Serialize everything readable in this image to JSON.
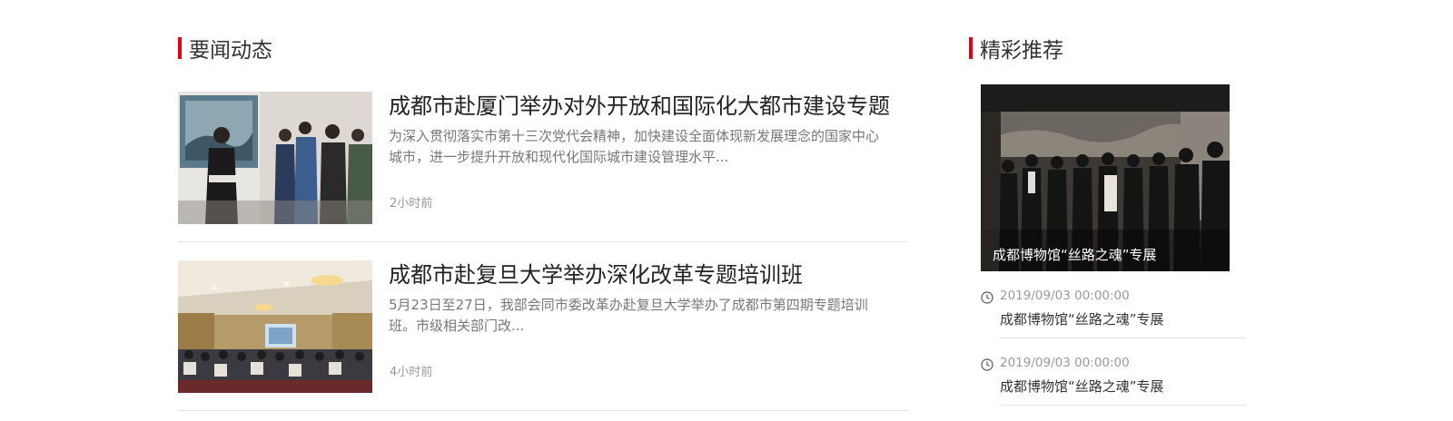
{
  "news_section": {
    "title": "要闻动态",
    "items": [
      {
        "headline": "成都市赴厦门举办对外开放和国际化大都市建设专题",
        "summary": "为深入贯彻落实市第十三次党代会精神，加快建设全面体现新发展理念的国家中心城市，进一步提升开放和现代化国际城市建设管理水平...",
        "time": "2小时前"
      },
      {
        "headline": "成都市赴复旦大学举办深化改革专题培训班",
        "summary": "5月23日至27日，我部会同市委改革办赴复旦大学举办了成都市第四期专题培训班。市级相关部门改...",
        "time": "4小时前"
      }
    ]
  },
  "recommend_section": {
    "title": "精彩推荐",
    "feature_caption": "成都博物馆“丝路之魂”专展",
    "items": [
      {
        "date": "2019/09/03 00:00:00",
        "title": "成都博物馆“丝路之魂”专展"
      },
      {
        "date": "2019/09/03 00:00:00",
        "title": "成都博物馆“丝路之魂”专展"
      }
    ]
  },
  "colors": {
    "accent": "#e60012",
    "text": "#333333",
    "muted": "#999999",
    "divider": "#e3e3e3"
  },
  "icons": {
    "time": "clock-icon"
  }
}
